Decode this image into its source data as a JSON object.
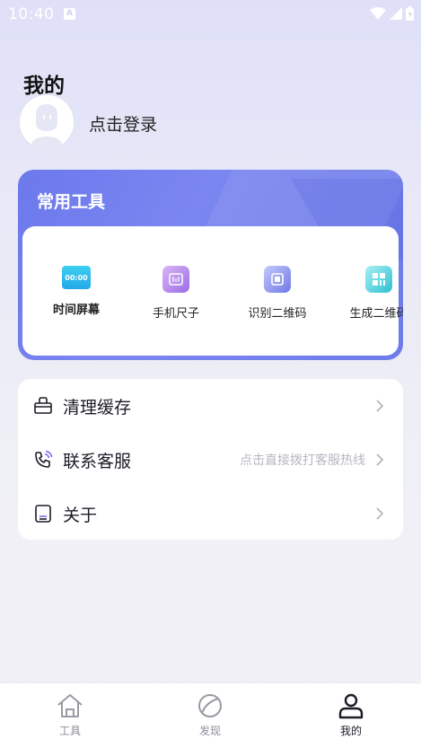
{
  "status_bar": {
    "time": "10:40",
    "notif_glyph": "A"
  },
  "header": {
    "title": "我的"
  },
  "profile": {
    "login_label": "点击登录"
  },
  "tools": {
    "title": "常用工具",
    "items": [
      {
        "label": "时间屏幕",
        "icon": "clock-screen-icon",
        "icon_text": "00:00"
      },
      {
        "label": "手机尺子",
        "icon": "ruler-icon"
      },
      {
        "label": "识别二维码",
        "icon": "scan-qr-icon"
      },
      {
        "label": "生成二维码",
        "icon": "generate-qr-icon"
      }
    ]
  },
  "menu": {
    "items": [
      {
        "label": "清理缓存",
        "hint": "",
        "icon": "basket-icon"
      },
      {
        "label": "联系客服",
        "hint": "点击直接拨打客服热线",
        "icon": "phone-icon"
      },
      {
        "label": "关于",
        "hint": "",
        "icon": "info-book-icon"
      }
    ]
  },
  "tabbar": {
    "items": [
      {
        "label": "工具",
        "icon": "home-icon",
        "active": false
      },
      {
        "label": "发现",
        "icon": "leaf-icon",
        "active": false
      },
      {
        "label": "我的",
        "icon": "user-icon",
        "active": true
      }
    ]
  },
  "colors": {
    "accent": "#6c79ec",
    "background": "#efeff6",
    "text": "#1c1c28",
    "hint": "#b7b7c2"
  }
}
